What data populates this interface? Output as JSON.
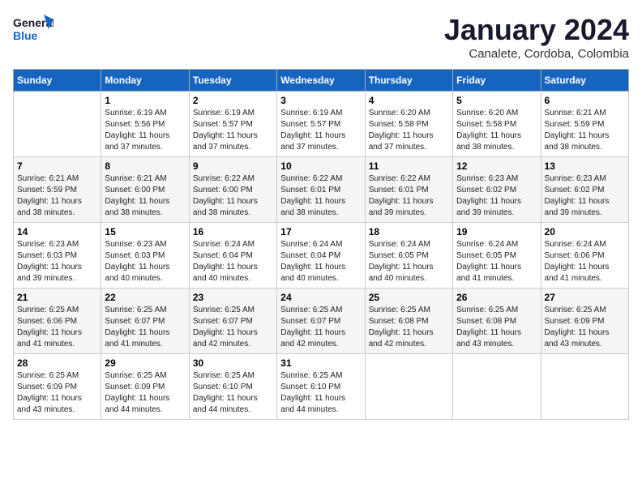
{
  "header": {
    "logo_general": "General",
    "logo_blue": "Blue",
    "month": "January 2024",
    "location": "Canalete, Cordoba, Colombia"
  },
  "days_of_week": [
    "Sunday",
    "Monday",
    "Tuesday",
    "Wednesday",
    "Thursday",
    "Friday",
    "Saturday"
  ],
  "weeks": [
    [
      {
        "day": "",
        "detail": ""
      },
      {
        "day": "1",
        "detail": "Sunrise: 6:19 AM\nSunset: 5:56 PM\nDaylight: 11 hours\nand 37 minutes."
      },
      {
        "day": "2",
        "detail": "Sunrise: 6:19 AM\nSunset: 5:57 PM\nDaylight: 11 hours\nand 37 minutes."
      },
      {
        "day": "3",
        "detail": "Sunrise: 6:19 AM\nSunset: 5:57 PM\nDaylight: 11 hours\nand 37 minutes."
      },
      {
        "day": "4",
        "detail": "Sunrise: 6:20 AM\nSunset: 5:58 PM\nDaylight: 11 hours\nand 37 minutes."
      },
      {
        "day": "5",
        "detail": "Sunrise: 6:20 AM\nSunset: 5:58 PM\nDaylight: 11 hours\nand 38 minutes."
      },
      {
        "day": "6",
        "detail": "Sunrise: 6:21 AM\nSunset: 5:59 PM\nDaylight: 11 hours\nand 38 minutes."
      }
    ],
    [
      {
        "day": "7",
        "detail": "Sunrise: 6:21 AM\nSunset: 5:59 PM\nDaylight: 11 hours\nand 38 minutes."
      },
      {
        "day": "8",
        "detail": "Sunrise: 6:21 AM\nSunset: 6:00 PM\nDaylight: 11 hours\nand 38 minutes."
      },
      {
        "day": "9",
        "detail": "Sunrise: 6:22 AM\nSunset: 6:00 PM\nDaylight: 11 hours\nand 38 minutes."
      },
      {
        "day": "10",
        "detail": "Sunrise: 6:22 AM\nSunset: 6:01 PM\nDaylight: 11 hours\nand 38 minutes."
      },
      {
        "day": "11",
        "detail": "Sunrise: 6:22 AM\nSunset: 6:01 PM\nDaylight: 11 hours\nand 39 minutes."
      },
      {
        "day": "12",
        "detail": "Sunrise: 6:23 AM\nSunset: 6:02 PM\nDaylight: 11 hours\nand 39 minutes."
      },
      {
        "day": "13",
        "detail": "Sunrise: 6:23 AM\nSunset: 6:02 PM\nDaylight: 11 hours\nand 39 minutes."
      }
    ],
    [
      {
        "day": "14",
        "detail": "Sunrise: 6:23 AM\nSunset: 6:03 PM\nDaylight: 11 hours\nand 39 minutes."
      },
      {
        "day": "15",
        "detail": "Sunrise: 6:23 AM\nSunset: 6:03 PM\nDaylight: 11 hours\nand 40 minutes."
      },
      {
        "day": "16",
        "detail": "Sunrise: 6:24 AM\nSunset: 6:04 PM\nDaylight: 11 hours\nand 40 minutes."
      },
      {
        "day": "17",
        "detail": "Sunrise: 6:24 AM\nSunset: 6:04 PM\nDaylight: 11 hours\nand 40 minutes."
      },
      {
        "day": "18",
        "detail": "Sunrise: 6:24 AM\nSunset: 6:05 PM\nDaylight: 11 hours\nand 40 minutes."
      },
      {
        "day": "19",
        "detail": "Sunrise: 6:24 AM\nSunset: 6:05 PM\nDaylight: 11 hours\nand 41 minutes."
      },
      {
        "day": "20",
        "detail": "Sunrise: 6:24 AM\nSunset: 6:06 PM\nDaylight: 11 hours\nand 41 minutes."
      }
    ],
    [
      {
        "day": "21",
        "detail": "Sunrise: 6:25 AM\nSunset: 6:06 PM\nDaylight: 11 hours\nand 41 minutes."
      },
      {
        "day": "22",
        "detail": "Sunrise: 6:25 AM\nSunset: 6:07 PM\nDaylight: 11 hours\nand 41 minutes."
      },
      {
        "day": "23",
        "detail": "Sunrise: 6:25 AM\nSunset: 6:07 PM\nDaylight: 11 hours\nand 42 minutes."
      },
      {
        "day": "24",
        "detail": "Sunrise: 6:25 AM\nSunset: 6:07 PM\nDaylight: 11 hours\nand 42 minutes."
      },
      {
        "day": "25",
        "detail": "Sunrise: 6:25 AM\nSunset: 6:08 PM\nDaylight: 11 hours\nand 42 minutes."
      },
      {
        "day": "26",
        "detail": "Sunrise: 6:25 AM\nSunset: 6:08 PM\nDaylight: 11 hours\nand 43 minutes."
      },
      {
        "day": "27",
        "detail": "Sunrise: 6:25 AM\nSunset: 6:09 PM\nDaylight: 11 hours\nand 43 minutes."
      }
    ],
    [
      {
        "day": "28",
        "detail": "Sunrise: 6:25 AM\nSunset: 6:09 PM\nDaylight: 11 hours\nand 43 minutes."
      },
      {
        "day": "29",
        "detail": "Sunrise: 6:25 AM\nSunset: 6:09 PM\nDaylight: 11 hours\nand 44 minutes."
      },
      {
        "day": "30",
        "detail": "Sunrise: 6:25 AM\nSunset: 6:10 PM\nDaylight: 11 hours\nand 44 minutes."
      },
      {
        "day": "31",
        "detail": "Sunrise: 6:25 AM\nSunset: 6:10 PM\nDaylight: 11 hours\nand 44 minutes."
      },
      {
        "day": "",
        "detail": ""
      },
      {
        "day": "",
        "detail": ""
      },
      {
        "day": "",
        "detail": ""
      }
    ]
  ]
}
